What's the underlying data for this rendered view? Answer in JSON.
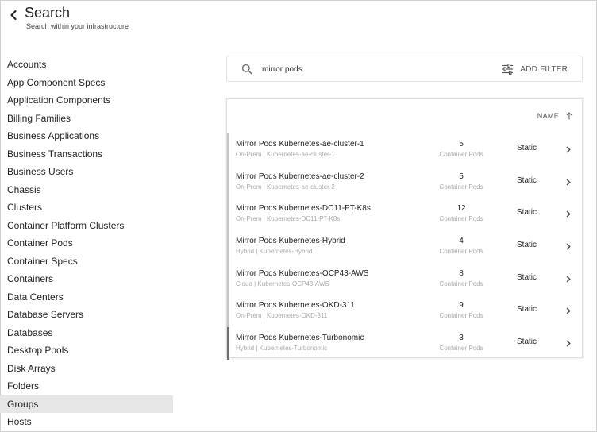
{
  "header": {
    "title": "Search",
    "subtitle": "Search within your infrastructure"
  },
  "sidebar": {
    "items": [
      {
        "label": "Accounts"
      },
      {
        "label": "App Component Specs"
      },
      {
        "label": "Application Components"
      },
      {
        "label": "Billing Families"
      },
      {
        "label": "Business Applications"
      },
      {
        "label": "Business Transactions"
      },
      {
        "label": "Business Users"
      },
      {
        "label": "Chassis"
      },
      {
        "label": "Clusters"
      },
      {
        "label": "Container Platform Clusters"
      },
      {
        "label": "Container Pods"
      },
      {
        "label": "Container Specs"
      },
      {
        "label": "Containers"
      },
      {
        "label": "Data Centers"
      },
      {
        "label": "Database Servers"
      },
      {
        "label": "Databases"
      },
      {
        "label": "Desktop Pools"
      },
      {
        "label": "Disk Arrays"
      },
      {
        "label": "Folders"
      },
      {
        "label": "Groups"
      },
      {
        "label": "Hosts"
      }
    ],
    "active": "Groups"
  },
  "search": {
    "value": "mirror pods",
    "icon": "search-icon",
    "add_filter_label": "ADD FILTER",
    "add_filter_icon": "sliders-icon"
  },
  "results": {
    "sort_label": "NAME",
    "sort_icon": "arrow-up-icon",
    "rows": [
      {
        "name": "Mirror Pods Kubernetes-ae-cluster-1",
        "sub": "On-Prem | Kubernetes-ae-cluster-1",
        "count": "5",
        "count_label": "Container Pods",
        "type": "Static"
      },
      {
        "name": "Mirror Pods Kubernetes-ae-cluster-2",
        "sub": "On-Prem | Kubernetes-ae-cluster-2",
        "count": "5",
        "count_label": "Container Pods",
        "type": "Static"
      },
      {
        "name": "Mirror Pods Kubernetes-DC11-PT-K8s",
        "sub": "On-Prem | Kubernetes-DC11-PT-K8s",
        "count": "12",
        "count_label": "Container Pods",
        "type": "Static"
      },
      {
        "name": "Mirror Pods Kubernetes-Hybrid",
        "sub": "Hybrid | Kubernetes-Hybrid",
        "count": "4",
        "count_label": "Container Pods",
        "type": "Static"
      },
      {
        "name": "Mirror Pods Kubernetes-OCP43-AWS",
        "sub": "Cloud | Kubernetes-OCP43-AWS",
        "count": "8",
        "count_label": "Container Pods",
        "type": "Static"
      },
      {
        "name": "Mirror Pods Kubernetes-OKD-311",
        "sub": "On-Prem | Kubernetes-OKD-311",
        "count": "9",
        "count_label": "Container Pods",
        "type": "Static"
      },
      {
        "name": "Mirror Pods Kubernetes-Turbonomic",
        "sub": "Hybrid | Kubernetes-Turbonomic",
        "count": "3",
        "count_label": "Container Pods",
        "type": "Static"
      }
    ]
  },
  "colors": {
    "active_item_bg": "#e6e6e6",
    "row_marker": "#c6c6c6",
    "row_marker_highlight": "#6f6f6f"
  }
}
